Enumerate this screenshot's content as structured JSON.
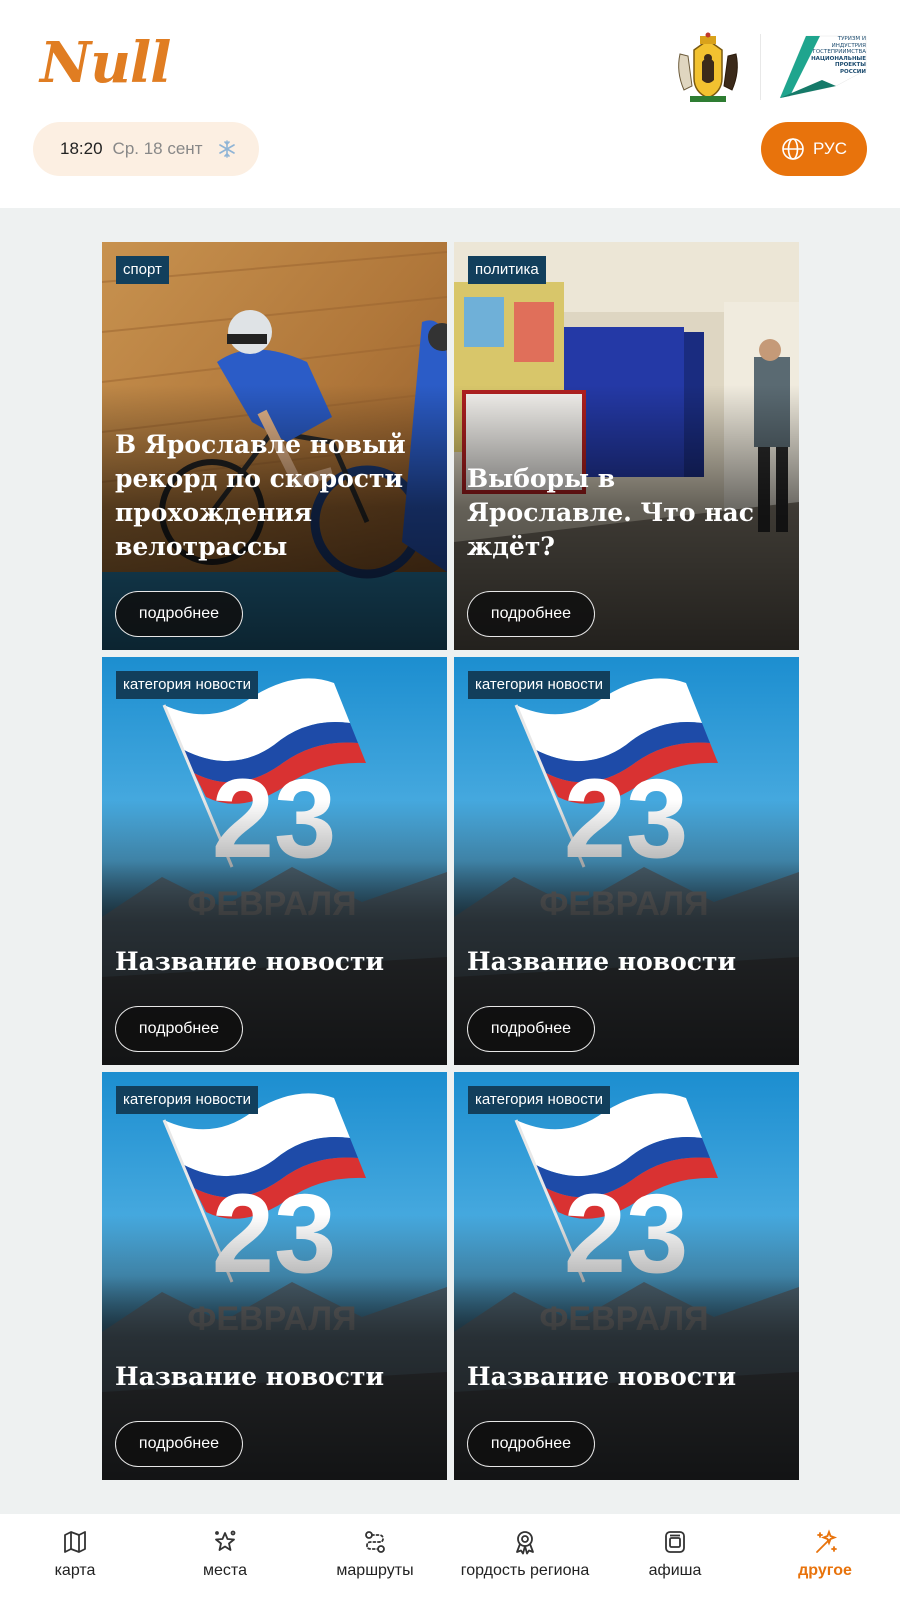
{
  "header": {
    "logo": "Null",
    "weather": {
      "time": "18:20",
      "date": "Ср. 18 сент",
      "icon": "snowflake-icon"
    },
    "language": {
      "label": "РУС",
      "icon": "globe-icon"
    },
    "national_projects": {
      "line1": "ТУРИЗМ И ИНДУСТРИЯ",
      "line2": "ГОСТЕПРИИМСТВА",
      "line3": "НАЦИОНАЛЬНЫЕ",
      "line4": "ПРОЕКТЫ",
      "line5": "РОССИИ"
    }
  },
  "colors": {
    "accent": "#e8730c",
    "badge": "#123f5c",
    "background": "#eef1f1",
    "logo": "#e07d22"
  },
  "news": [
    {
      "category": "спорт",
      "title": "В Ярославле новый рекорд по скорости прохождения велотрассы",
      "button": "подробнее",
      "image": "cycling-photo"
    },
    {
      "category": "политика",
      "title": "Выборы в Ярославле. Что нас ждёт?",
      "button": "подробнее",
      "image": "election-photo"
    },
    {
      "category": "категория новости",
      "title": "Название новости",
      "button": "подробнее",
      "image": "feb23-poster"
    },
    {
      "category": "категория новости",
      "title": "Название новости",
      "button": "подробнее",
      "image": "feb23-poster"
    },
    {
      "category": "категория новости",
      "title": "Название новости",
      "button": "подробнее",
      "image": "feb23-poster"
    },
    {
      "category": "категория новости",
      "title": "Название новости",
      "button": "подробнее",
      "image": "feb23-poster"
    }
  ],
  "poster": {
    "number": "23",
    "month": "ФЕВРАЛЯ"
  },
  "nav": [
    {
      "label": "карта",
      "icon": "map-icon",
      "active": false
    },
    {
      "label": "места",
      "icon": "places-icon",
      "active": false
    },
    {
      "label": "маршруты",
      "icon": "route-icon",
      "active": false
    },
    {
      "label": "гордость региона",
      "icon": "award-icon",
      "active": false
    },
    {
      "label": "афиша",
      "icon": "poster-icon",
      "active": false
    },
    {
      "label": "другое",
      "icon": "other-icon",
      "active": true
    }
  ]
}
